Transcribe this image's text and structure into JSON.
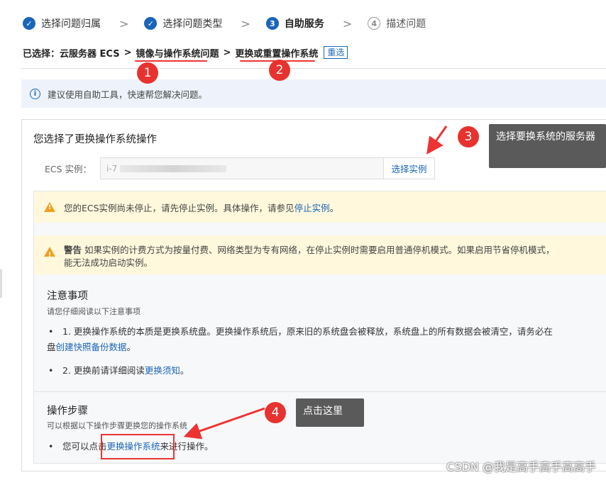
{
  "steps": [
    {
      "num": "✓",
      "label": "选择问题归属"
    },
    {
      "num": "✓",
      "label": "选择问题类型"
    },
    {
      "num": "3",
      "label": "自助服务"
    },
    {
      "num": "4",
      "label": "描述问题"
    }
  ],
  "step_separator": ">",
  "breadcrumb": {
    "prefix": "已选择：",
    "items": [
      "云服务器 ECS",
      "镜像与操作系统问题",
      "更换或重置操作系统"
    ],
    "separator": ">",
    "reselect": "重选"
  },
  "tip": {
    "icon": "i",
    "text": "建议使用自助工具，快速帮您解决问题。"
  },
  "panel": {
    "title": "您选择了更换操作系统操作",
    "ecs_label": "ECS 实例：",
    "ecs_value": "i-7",
    "select_button": "选择实例",
    "warning1": {
      "text": "您的ECS实例尚未停止，请先停止实例。具体操作，请参见",
      "link": "停止实例",
      "end": "。"
    },
    "warning2": {
      "bold": "警告",
      "text": " 如果实例的计费方式为按量付费、网络类型为专有网络，在停止实例时需要启用普通停机模式。如果启用节省停机模式，",
      "line2": "能无法成功启动实例。"
    },
    "notes": {
      "title": "注意事项",
      "subtitle": "请您仔细阅读以下注意事项",
      "item1_text": "1. 更换操作系统的本质是更换系统盘。更换操作系统后，原来旧的系统盘会被释放，系统盘上的所有数据会被清空，请务必在",
      "item1_line2_prefix": "盘",
      "item1_link": "创建快照备份数据",
      "item1_end": "。",
      "item2_text": "2. 更换前请详细阅读",
      "item2_link": "更换须知",
      "item2_end": "。"
    },
    "steps": {
      "title": "操作步骤",
      "subtitle": "可以根据以下操作步骤更换您的操作系统",
      "item_text": "您可以点击",
      "item_link": "更换操作系统",
      "item_end": "来进行操作。"
    }
  },
  "annotations": {
    "badge1": "1",
    "badge2": "2",
    "badge3": "3",
    "badge4": "4",
    "callout3": "选择要换系统的服务器",
    "callout4": "点击这里"
  },
  "watermark": "CSDN @我是高手高手高高手",
  "colors": {
    "primary": "#1a65b8",
    "annotation_red": "#e8322f",
    "warning_bg": "#fff8dd",
    "tip_bg": "#eef3fb"
  }
}
